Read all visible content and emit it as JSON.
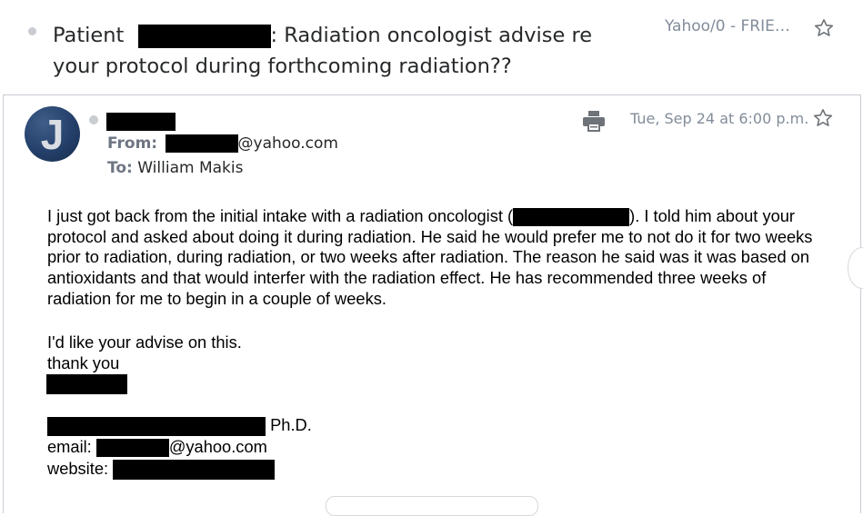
{
  "thread": {
    "subject_prefix": "Patient",
    "subject_rest": ": Radiation oncologist advise re your protocol during forthcoming radiation??",
    "folder": "Yahoo/0 - FRIE…"
  },
  "message": {
    "avatar_letter": "J",
    "from_label": "From:",
    "from_domain": "@yahoo.com",
    "to_label": "To:",
    "to_name": "William Makis",
    "date": "Tue, Sep 24 at 6:00 p.m.",
    "body_part1": "I just got back from the initial intake with a radiation oncologist (",
    "body_part2": "). I told him about your protocol and asked about doing it during radiation. He said he would prefer me to not do it for two weeks prior to radiation, during radiation, or two weeks after radiation. The reason he said was it was based on antioxidants and that would interfer with the radiation effect. He has recommended three weeks of radiation for me to begin in a couple of weeks.",
    "closing_line1": "I'd like your advise on this.",
    "closing_line2": "thank you",
    "sig_title": "Ph.D.",
    "sig_email_label": "email:",
    "sig_email_domain": "@yahoo.com",
    "sig_website_label": "website:"
  },
  "icons": {
    "thread_star": "star-outline-icon",
    "message_star": "star-outline-icon",
    "print": "printer-icon"
  },
  "colors": {
    "muted": "#828c9a",
    "label": "#6e7683",
    "redaction": "#000000"
  }
}
